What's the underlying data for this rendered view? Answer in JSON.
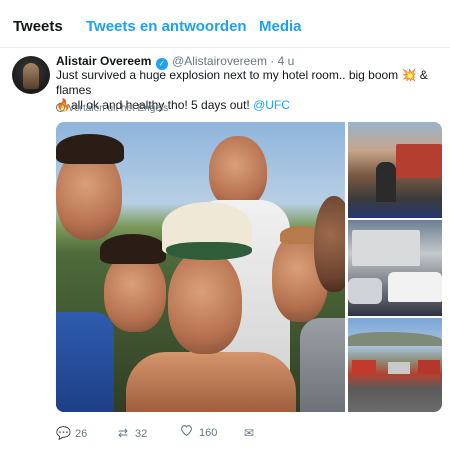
{
  "tabs": [
    {
      "label": "Tweets",
      "active": true
    },
    {
      "label": "Tweets en antwoorden",
      "active": false
    },
    {
      "label": "Media",
      "active": false
    }
  ],
  "tweet": {
    "author_name": "Alistair Overeem",
    "verified": true,
    "handle": "@Alistairovereem",
    "separator": "·",
    "time": "4 u",
    "text_part1": "Just survived a huge explosion next to my hotel room.. big boom ",
    "emoji_boom": "💥",
    "text_part2": " & flames",
    "emoji_fire": "🔥",
    "text_part3": "all ok and healthy tho! 5 days out! ",
    "mention": "@UFC",
    "translate_label": "Vertalen uit het Engels"
  },
  "actions": {
    "reply_count": "26",
    "retweet_count": "32",
    "like_count": "160"
  },
  "icons": {
    "reply": "reply-icon",
    "retweet": "retweet-icon",
    "like": "heart-icon",
    "message": "envelope-icon",
    "translate": "globe-icon",
    "verified": "verified-badge-icon"
  },
  "colors": {
    "accent": "#1da1f2",
    "text": "#14171a",
    "secondary": "#657786",
    "divider": "#e6ecf0"
  }
}
